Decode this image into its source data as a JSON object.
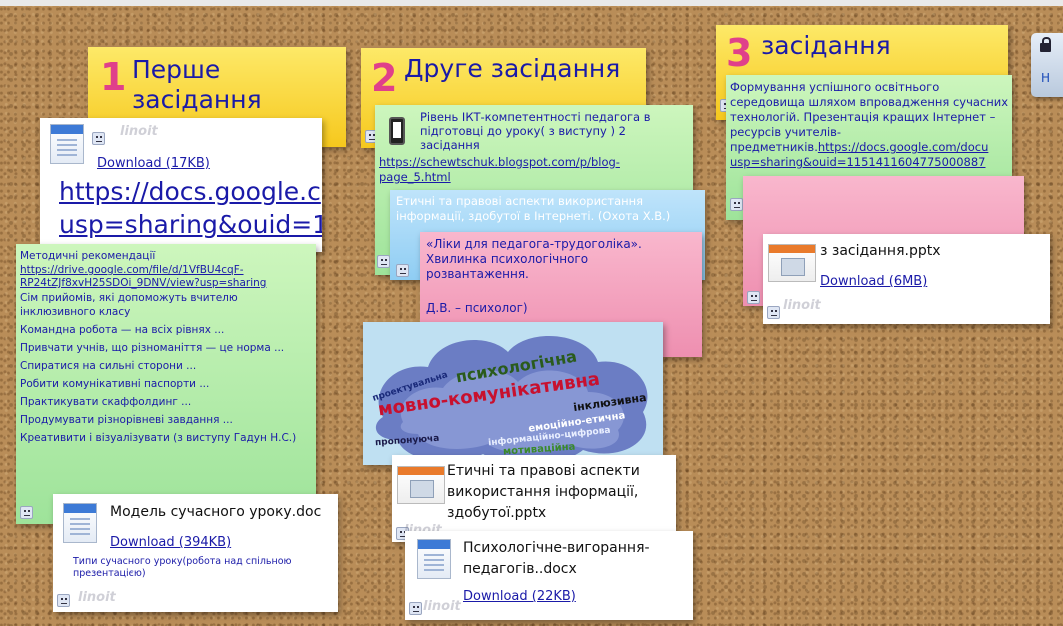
{
  "watermark": "linoit",
  "note1": {
    "number": "1",
    "title": "Перше засідання",
    "download": "Download (17KB)",
    "big_link_line1": "https://docs.google.c",
    "big_link_line2": "usp=sharing&ouid=1"
  },
  "note_methods": {
    "title": "Методичні рекомендації",
    "link_line1": "https://drive.google.com/file/d/1VfBU4cqF-",
    "link_line2": "RP24tZJf8xvH25SDOi_9DNV/view?usp=sharing",
    "items": [
      "Сім прийомів, які допоможуть вчителю інклюзивного класу",
      "Командна робота — на всіх рівнях ...",
      "Привчати учнів, що різноманіття — це норма ...",
      "Спиратися на сильні сторони ...",
      "Робити комунікативні паспорти ...",
      "Практикувати скаффолдинг ...",
      "Продумувати різнорівневі завдання ...",
      "Креативити і візуалізувати (з виступу Гадун Н.С.)"
    ]
  },
  "note_model": {
    "filename": "Модель сучасного уроку.doc",
    "download": "Download (394KB)",
    "caption": "Типи сучасного уроку(робота над спільною презентацією)"
  },
  "note2": {
    "number": "2",
    "title": "Друге засідання"
  },
  "note_ikt": {
    "text": "Рівень ІКТ-компетентності педагога в підготовці до уроку( з виступу ) 2 засідання",
    "link_line1": "https://schewtschuk.blogspot.com/p/blog-",
    "link_line2": "page_5.html"
  },
  "note_ethics": {
    "text": "Етичні та правові аспекти використання інформації, здобутої в Інтернеті. (Охота Х.В.)"
  },
  "note_liky": {
    "text": "«Ліки для педагога-трудоголіка». Хвилинка психологічного розвантаження.",
    "author": "Д.В. – психолог)"
  },
  "word_cloud": {
    "words": [
      "психологічна",
      "мовно-комунікативна",
      "інклюзивна",
      "проектувальна",
      "емоційно-етична",
      "інформаційно-цифрова",
      "пропонуюча",
      "мотиваційна"
    ]
  },
  "note_ethics_file": {
    "filename": "Етичні та правові аспекти використання інформації, здобутої.pptx"
  },
  "note_burnout": {
    "filename": "Психологічне-вигорання-педагогів..docx",
    "download": "Download (22KB)"
  },
  "note3": {
    "number": "3",
    "title": "засідання"
  },
  "note_env": {
    "text": "Формування успішного освітнього середовища шляхом впровадження сучасних технологій. Презентація кращих Інтернет – ресурсів учителів-предметників.",
    "link_part1": "https://docs.google.com/docu",
    "link_part2": "usp=sharing&ouid=1151411604775000887"
  },
  "note_pptx3": {
    "filename": "з засідання.pptx",
    "download": "Download (6MB)"
  },
  "side_widget": {
    "label": "Н"
  },
  "colors": {
    "title_blue": "#1a1aa8",
    "number_pink": "#e0408a",
    "cork": "#b98d58"
  }
}
